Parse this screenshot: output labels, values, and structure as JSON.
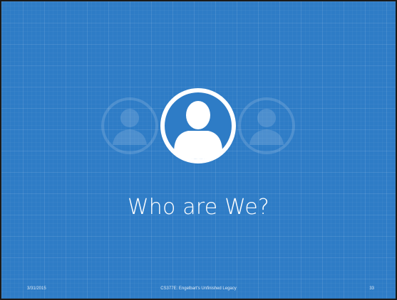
{
  "slide": {
    "title": "Who are We?",
    "footer": {
      "date": "3/31/2015",
      "course": "CS377E: Engelbart's Unfinished Legacy",
      "page_number": "33"
    },
    "icons": {
      "center": "user-icon",
      "left": "user-icon",
      "right": "user-icon"
    },
    "colors": {
      "background": "#2e7cc6",
      "foreground": "#ffffff"
    }
  }
}
